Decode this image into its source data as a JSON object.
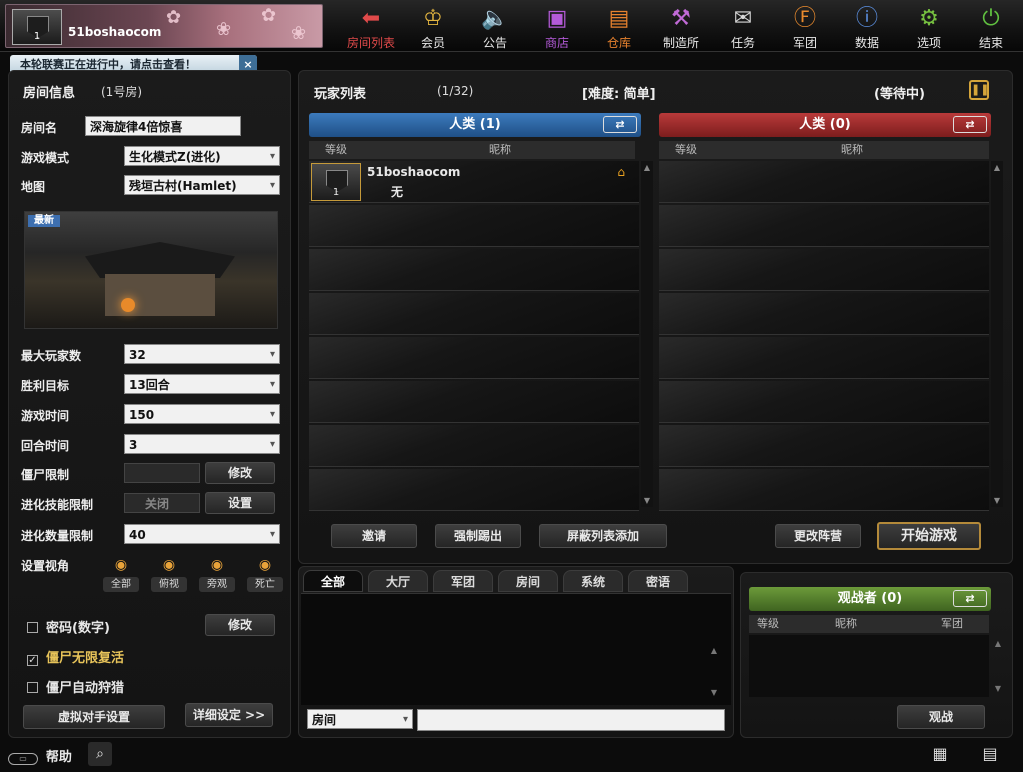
{
  "player": {
    "name": "51boshaocom",
    "level": "1"
  },
  "nav": [
    {
      "id": "room-list",
      "label": "房间列表",
      "icon": "arrow-left-icon",
      "color": "#e04a4a",
      "glyph": "⬅"
    },
    {
      "id": "vip",
      "label": "会员",
      "icon": "crown-icon",
      "color": "#e4b640",
      "glyph": "♔"
    },
    {
      "id": "notice",
      "label": "公告",
      "icon": "speaker-icon",
      "color": "#6fa8e0",
      "glyph": "🔈"
    },
    {
      "id": "shop",
      "label": "商店",
      "icon": "shop-icon",
      "color": "#b45ad8",
      "glyph": "▣"
    },
    {
      "id": "storage",
      "label": "仓库",
      "icon": "briefcase-icon",
      "color": "#e8822e",
      "glyph": "▤"
    },
    {
      "id": "crafting",
      "label": "制造所",
      "icon": "crafting-icon",
      "color": "#c06ad6",
      "glyph": "⚒"
    },
    {
      "id": "missions",
      "label": "任务",
      "icon": "ticket-icon",
      "color": "#d8d8d8",
      "glyph": "✉"
    },
    {
      "id": "clan",
      "label": "军团",
      "icon": "clan-shield-icon",
      "color": "#e88a2e",
      "glyph": "Ⓕ"
    },
    {
      "id": "stats",
      "label": "数据",
      "icon": "info-icon",
      "color": "#5b8fe0",
      "glyph": "ⓘ"
    },
    {
      "id": "options",
      "label": "选项",
      "icon": "gear-icon",
      "color": "#76c040",
      "glyph": "⚙"
    },
    {
      "id": "quit",
      "label": "结束",
      "icon": "power-icon",
      "color": "#60c040",
      "glyph": "⏻"
    }
  ],
  "notice": {
    "text": "本轮联赛正在进行中，请点击查看！",
    "close": "×"
  },
  "room": {
    "title": "房间信息",
    "number": "(1号房)",
    "name_label": "房间名",
    "name_value": "深海旋律4倍惊喜",
    "mode_label": "游戏模式",
    "mode_value": "生化模式Z(进化)",
    "map_label": "地图",
    "map_value": "残垣古村(Hamlet)",
    "map_badge": "最新",
    "max_players_label": "最大玩家数",
    "max_players_value": "32",
    "win_target_label": "胜利目标",
    "win_target_value": "13回合",
    "game_time_label": "游戏时间",
    "game_time_value": "150",
    "round_time_label": "回合时间",
    "round_time_value": "3",
    "zombie_limit_label": "僵尸限制",
    "zombie_limit_btn": "修改",
    "evo_skill_label": "进化技能限制",
    "evo_skill_value": "关闭",
    "evo_skill_btn": "设置",
    "evo_count_label": "进化数量限制",
    "evo_count_value": "40",
    "view_label": "设置视角",
    "views": [
      {
        "label": "全部",
        "icon": "all-view-icon"
      },
      {
        "label": "俯视",
        "icon": "top-view-icon"
      },
      {
        "label": "旁观",
        "icon": "side-view-icon"
      },
      {
        "label": "死亡",
        "icon": "death-view-icon"
      }
    ],
    "password_label": "密码(数字)",
    "password_btn": "修改",
    "zombie_revive_label": "僵尸无限复活",
    "zombie_hunt_label": "僵尸自动狩猎",
    "bot_settings": "虚拟对手设置",
    "detail_settings": "详细设定 >>"
  },
  "players": {
    "title": "玩家列表",
    "count": "(1/32)",
    "difficulty": "[难度: 简单]",
    "status": "(等待中)",
    "team_left": "人类 (1)",
    "team_right": "人类 (0)",
    "col_level": "等级",
    "col_nick": "昵称",
    "left_players": [
      {
        "name": "51boshaocom",
        "sub": "无",
        "level": "1"
      }
    ],
    "slots": 8,
    "invite": "邀请",
    "kick": "强制踢出",
    "block_add": "屏蔽列表添加",
    "change_team": "更改阵营",
    "start": "开始游戏"
  },
  "chat": {
    "tabs": [
      "全部",
      "大厅",
      "军团",
      "房间",
      "系统",
      "密语"
    ],
    "channel": "房间",
    "input_value": ""
  },
  "spectators": {
    "title": "观战者 (0)",
    "col_level": "等级",
    "col_nick": "昵称",
    "col_clan": "军团",
    "spectate_btn": "观战"
  },
  "bottom": {
    "help": "帮助"
  }
}
